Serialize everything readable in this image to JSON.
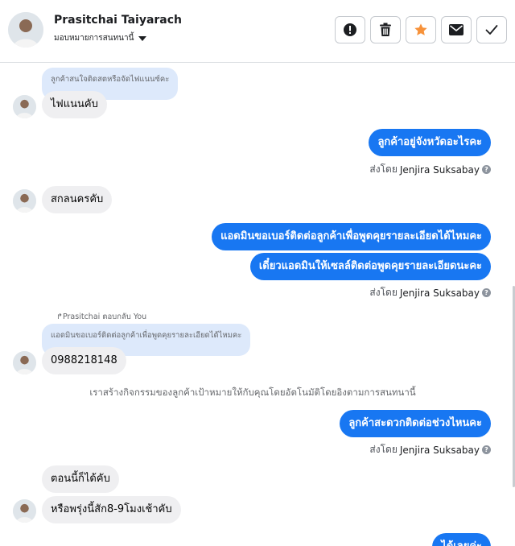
{
  "header": {
    "name": "Prasitchai Taiyarach",
    "assign_label": "มอบหมายการสนทนานี้",
    "actions": [
      "spam-icon",
      "trash-icon",
      "star-icon",
      "mail-icon",
      "check-icon"
    ],
    "star_color": "#f7923a"
  },
  "colors": {
    "outgoing": "#1877f2",
    "incoming": "#efeff1",
    "quote": "#dde9fb"
  },
  "messages": {
    "m1_quote": "ลูกค้าสนใจติดสตหรือจัดไฟแนนซ์คะ",
    "m1": "ไฟแนนคับ",
    "m2": "ลูกค้าอยู่จังหวัดอะไรคะ",
    "m3": "สกลนครคับ",
    "m4": "แอดมินขอเบอร์ติดต่อลูกค้าเพื่อพูดคุยรายละเอียดได้ไหมคะ",
    "m5": "เดี๋ยวแอดมินให้เซลล์ติดต่อพูดคุยรายละเอียดนะคะ",
    "m6_replied_label": "Prasitchai ตอบกลับ You",
    "m6_quote": "แอดมินขอเบอร์ติดต่อลูกค้าเพื่อพูดคุยรายละเอียดได้ไหมคะ",
    "m6": "0988218148",
    "notice": "เราสร้างกิจกรรมของลูกค้าเป้าหมายให้กับคุณโดยอัตโนมัติโดยอิงตามการสนทนานี้",
    "m7": "ลูกค้าสะดวกติดต่อช่วงไหนคะ",
    "m8": "ตอนนี้ก็ได้คับ",
    "m9": "หรือพรุ่งนี้สัก8-9โมงเช้าคับ",
    "m10": "ได้เลยค่ะ"
  },
  "sent_by": {
    "prefix": "ส่งโดย",
    "agent": "Jenjira Suksabay"
  }
}
